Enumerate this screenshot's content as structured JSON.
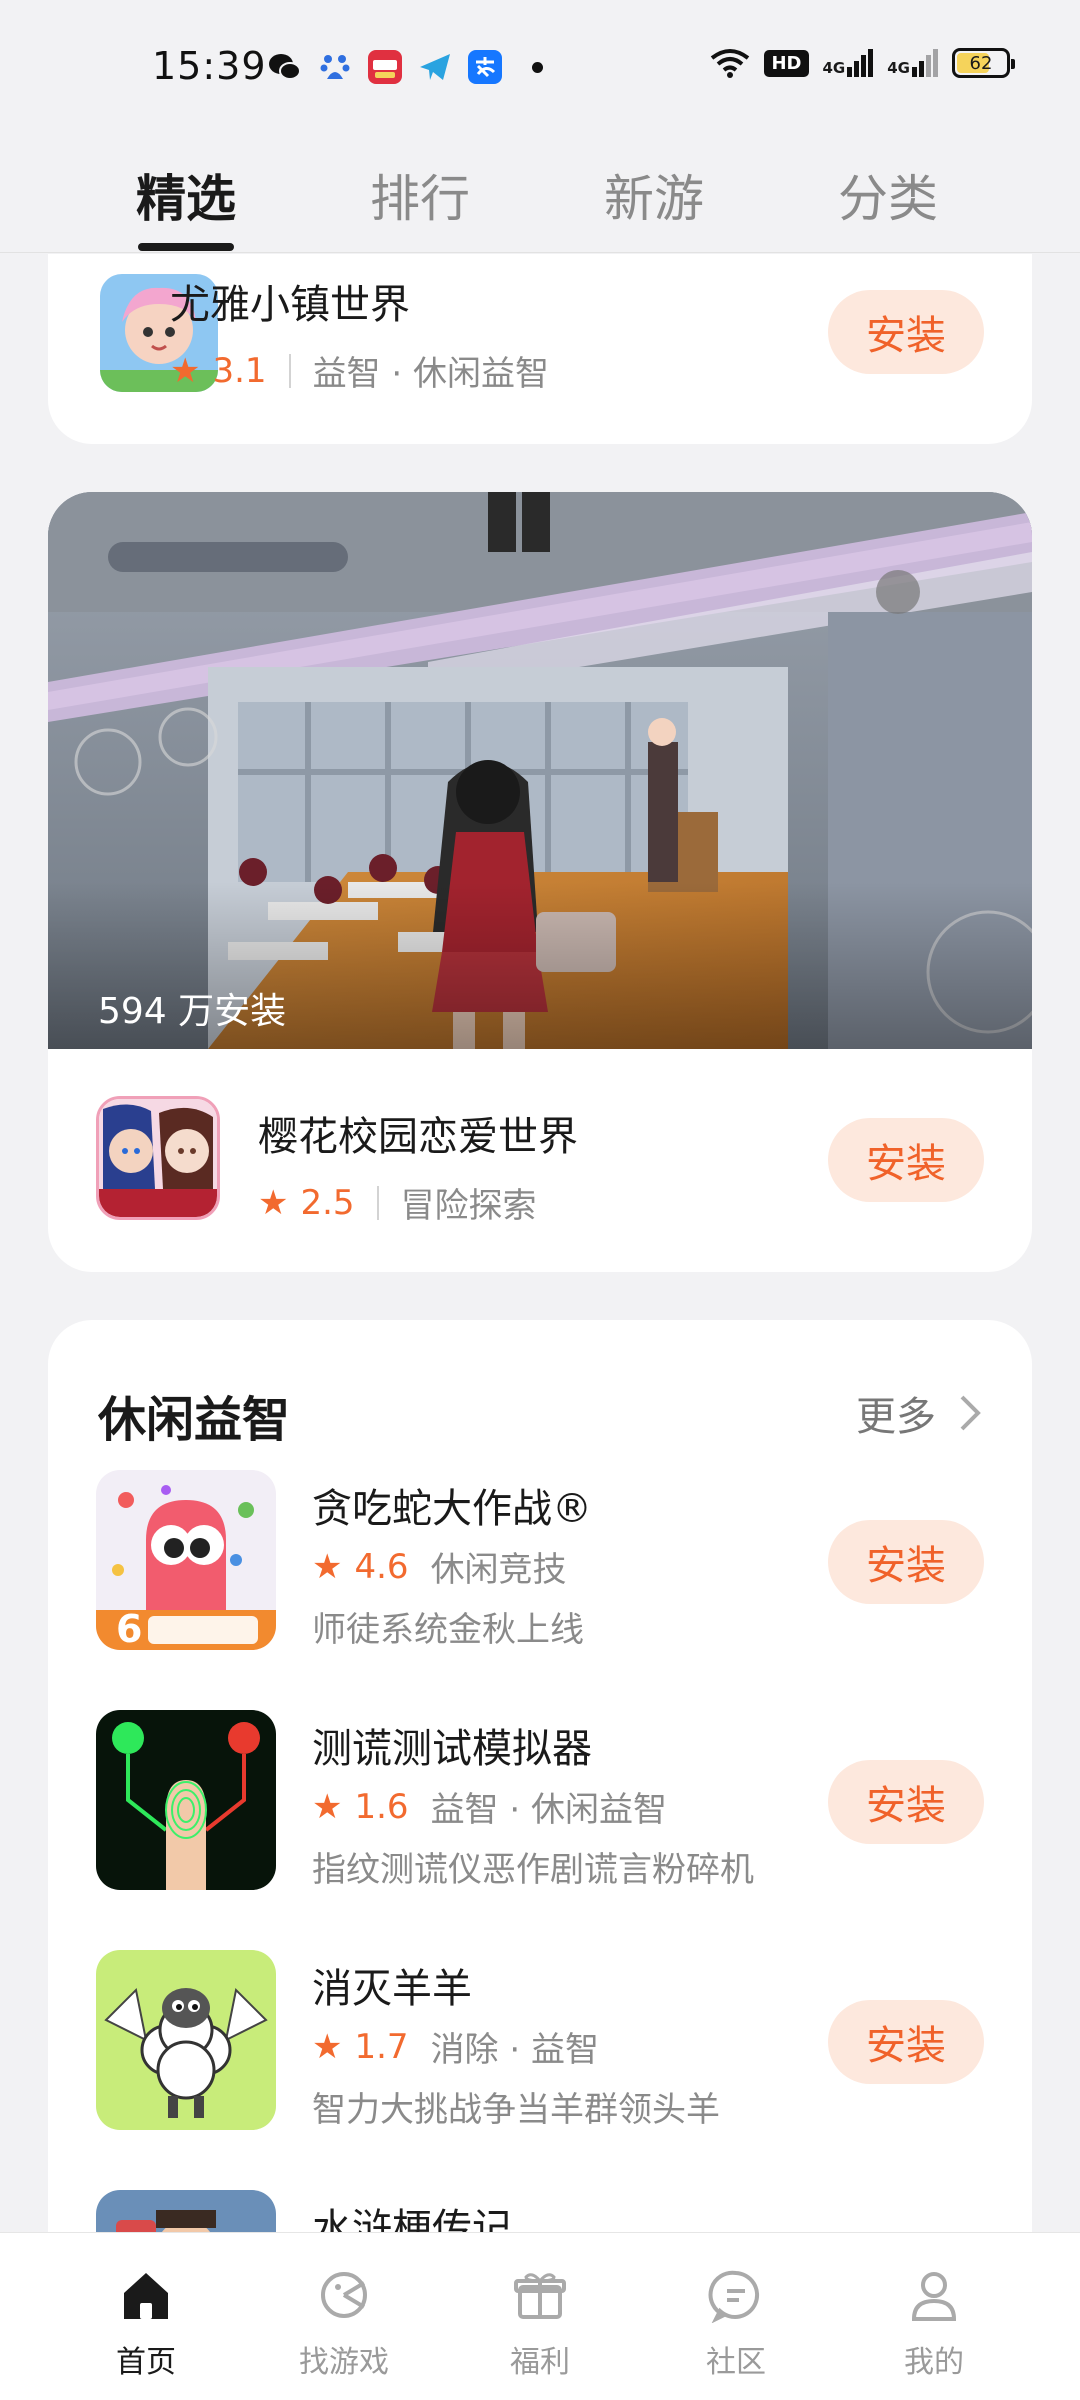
{
  "status_bar": {
    "time": "15:39",
    "network": "HD",
    "signal_1": "4G",
    "signal_2": "4G",
    "battery": "62",
    "apps": [
      "wechat-icon",
      "baidu-icon",
      "xiaohongshu-icon",
      "telegram-icon",
      "alipay-icon"
    ]
  },
  "top_tabs": [
    {
      "label": "精选",
      "active": true
    },
    {
      "label": "排行",
      "active": false
    },
    {
      "label": "新游",
      "active": false
    },
    {
      "label": "分类",
      "active": false
    }
  ],
  "top_card": {
    "name": "尤雅小镇世界",
    "rating": "3.1",
    "tags": "益智 · 休闲益智",
    "install": "安装"
  },
  "featured": {
    "install_count": "594 万安装",
    "name": "樱花校园恋爱世界",
    "rating": "2.5",
    "tags": "冒险探索",
    "install": "安装"
  },
  "section": {
    "title": "休闲益智",
    "more": "更多",
    "apps": [
      {
        "name": "贪吃蛇大作战®",
        "rating": "4.6",
        "tags": "休闲竞技",
        "desc": "师徒系统金秋上线",
        "install": "安装"
      },
      {
        "name": "测谎测试模拟器",
        "rating": "1.6",
        "tags": "益智 · 休闲益智",
        "desc": "指纹测谎仪恶作剧谎言粉碎机",
        "install": "安装"
      },
      {
        "name": "消灭羊羊",
        "rating": "1.7",
        "tags": "消除 · 益智",
        "desc": "智力大挑战争当羊群领头羊",
        "install": "安装"
      },
      {
        "name": "水浒梗传记"
      }
    ]
  },
  "bottom_nav": [
    {
      "label": "首页",
      "icon": "home-icon",
      "active": true
    },
    {
      "label": "找游戏",
      "icon": "find-game-icon",
      "active": false
    },
    {
      "label": "福利",
      "icon": "gift-icon",
      "active": false
    },
    {
      "label": "社区",
      "icon": "community-icon",
      "active": false
    },
    {
      "label": "我的",
      "icon": "profile-icon",
      "active": false
    }
  ],
  "colors": {
    "accent": "#f0622a",
    "install_bg": "#fde8dd",
    "page_bg": "#f2f2f4"
  }
}
